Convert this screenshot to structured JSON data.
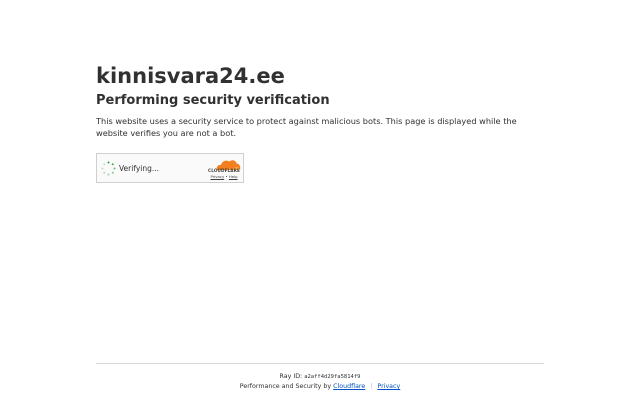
{
  "site": {
    "title": "kinnisvara24.ee"
  },
  "main": {
    "heading": "Performing security verification",
    "description": "This website uses a security service to protect against malicious bots. This page is displayed while the website verifies you are not a bot."
  },
  "widget": {
    "status": "Verifying...",
    "brand": "CLOUDFLARE",
    "privacy_link": "Privacy",
    "link_separator": "•",
    "help_link": "Help",
    "brand_color": "#f38020"
  },
  "footer": {
    "ray_label": "Ray ID:",
    "ray_id": "a2aff4d29fa5814f9",
    "performance_text": "Performance and Security by",
    "cloudflare_link": "Cloudflare",
    "separator": "|",
    "privacy_link": "Privacy",
    "link_color": "#0051c3"
  }
}
